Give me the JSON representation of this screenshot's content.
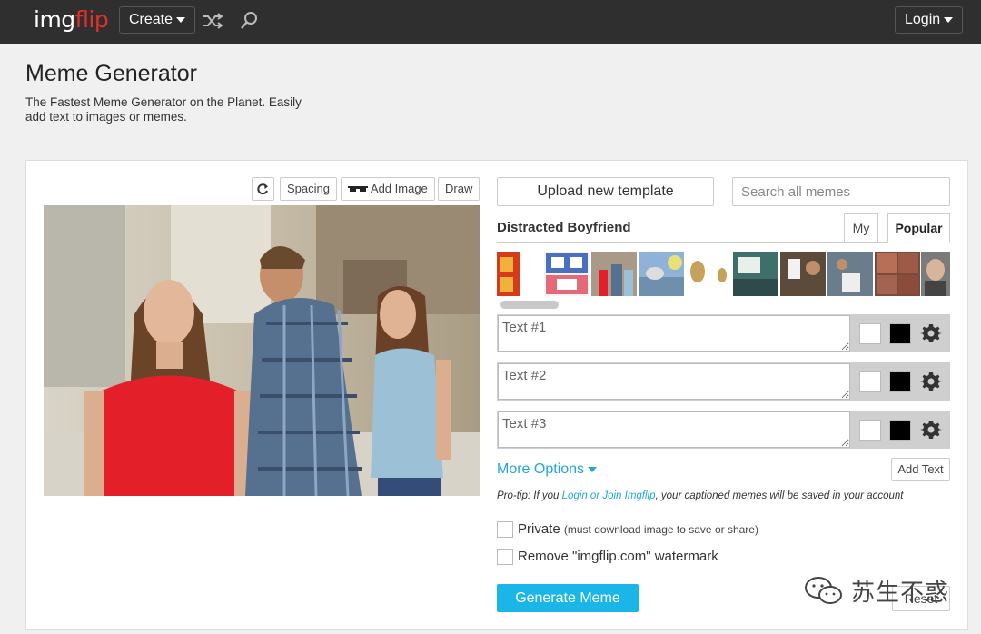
{
  "nav": {
    "logo_part1": "img",
    "logo_part2": "flip",
    "create_label": "Create",
    "login_label": "Login",
    "icons": [
      "shuffle-icon",
      "search-icon"
    ]
  },
  "header": {
    "title": "Meme Generator",
    "subtitle": "The Fastest Meme Generator on the Planet. Easily add text to images or memes."
  },
  "editor_toolbar": {
    "rotate_icon": "rotate-icon",
    "spacing_label": "Spacing",
    "add_image_label": "Add Image",
    "draw_label": "Draw"
  },
  "templates": {
    "upload_label": "Upload new template",
    "search_placeholder": "Search all memes",
    "selected_name": "Distracted Boyfriend",
    "tabs": [
      {
        "label": "My",
        "active": false
      },
      {
        "label": "Popular",
        "active": true
      }
    ]
  },
  "text_boxes": [
    {
      "placeholder": "Text #1",
      "fill_color": "#ffffff",
      "outline_color": "#000000"
    },
    {
      "placeholder": "Text #2",
      "fill_color": "#ffffff",
      "outline_color": "#000000"
    },
    {
      "placeholder": "Text #3",
      "fill_color": "#ffffff",
      "outline_color": "#000000"
    }
  ],
  "options": {
    "more_options_label": "More Options",
    "add_text_label": "Add Text",
    "protip_prefix": "Pro-tip: If you ",
    "protip_link": "Login or Join Imgflip",
    "protip_suffix": ", your captioned memes will be saved in your account",
    "private_label": "Private",
    "private_note": "(must download image to save or share)",
    "watermark_label": "Remove \"imgflip.com\" watermark",
    "generate_label": "Generate Meme",
    "reset_label": "Reset"
  },
  "overlay_watermark": "苏生不惑",
  "colors": {
    "topbar": "#2f2f2f",
    "logo_accent": "#e0302a",
    "link_blue": "#1fa6e0",
    "generate_button": "#1ab6e8"
  }
}
